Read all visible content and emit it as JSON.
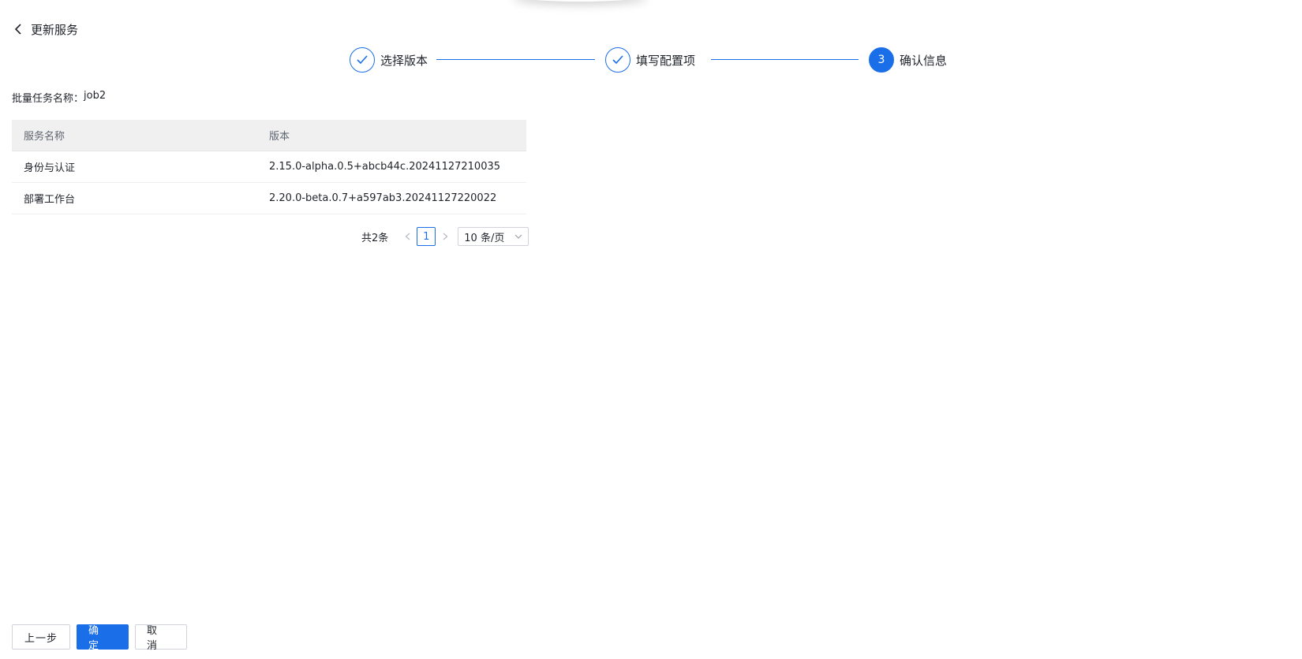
{
  "header": {
    "title": "更新服务",
    "back_icon": "chevron-left-icon"
  },
  "steps": [
    {
      "label": "选择版本",
      "status": "done",
      "icon": "check-icon"
    },
    {
      "label": "填写配置项",
      "status": "done",
      "icon": "check-icon"
    },
    {
      "label": "确认信息",
      "status": "active",
      "number": "3"
    }
  ],
  "job": {
    "label": "批量任务名称：",
    "value": "job2"
  },
  "table": {
    "headers": [
      "服务名称",
      "版本"
    ],
    "rows": [
      [
        "身份与认证",
        "2.15.0-alpha.0.5+abcb44c.20241127210035"
      ],
      [
        "部署工作台",
        "2.20.0-beta.0.7+a597ab3.20241127220022"
      ]
    ]
  },
  "pagination": {
    "total": "共2条",
    "current_page": "1",
    "page_size": "10 条/页",
    "prev_icon": "chevron-left-icon",
    "next_icon": "chevron-right-icon"
  },
  "footer": {
    "prev_label": "上一步",
    "confirm_label": "确 定",
    "cancel_label": "取 消"
  },
  "colors": {
    "accent": "#1a6fe8",
    "header_bg": "#f0f0f0"
  }
}
